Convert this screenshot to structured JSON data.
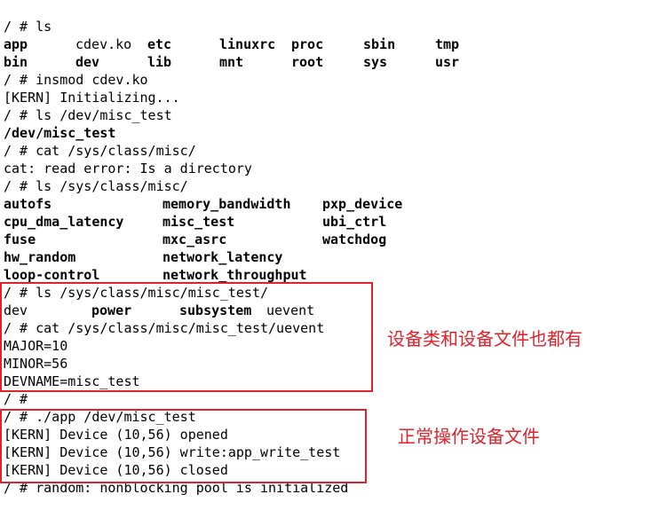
{
  "terminal": {
    "l01": "/ # ls",
    "ls_root": [
      "app",
      "cdev.ko",
      "etc",
      "linuxrc",
      "proc",
      "sbin",
      "tmp",
      "bin",
      "dev",
      "lib",
      "mnt",
      "root",
      "sys",
      "usr"
    ],
    "l04": "/ # insmod cdev.ko",
    "l05": "[KERN] Initializing...",
    "l06": "/ # ls /dev/misc_test",
    "l07": "/dev/misc_test",
    "l08": "/ # cat /sys/class/misc/",
    "l09": "cat: read error: Is a directory",
    "l10": "/ # ls /sys/class/misc/",
    "misc_list": [
      "autofs",
      "memory_bandwidth",
      "pxp_device",
      "cpu_dma_latency",
      "misc_test",
      "ubi_ctrl",
      "fuse",
      "mxc_asrc",
      "watchdog",
      "hw_random",
      "network_latency",
      "loop-control",
      "network_throughput"
    ],
    "l16": "/ # ls /sys/class/misc/misc_test/",
    "misc_test_list": [
      "dev",
      "power",
      "subsystem",
      "uevent"
    ],
    "l18": "/ # cat /sys/class/misc/misc_test/uevent",
    "l19": "MAJOR=10",
    "l20": "MINOR=56",
    "l21": "DEVNAME=misc_test",
    "l22": "/ #",
    "l23": "/ # ./app /dev/misc_test",
    "l24": "[KERN] Device (10,56) opened",
    "l25": "[KERN] Device (10,56) write:app_write_test",
    "l26": "[KERN] Device (10,56) closed",
    "l27": "/ # random: nonblocking pool is initialized"
  },
  "annotations": {
    "note1": "设备类和设备文件也都有",
    "note2": "正常操作设备文件"
  },
  "colors": {
    "highlight": "#e0222b",
    "text": "#000000",
    "background": "#ffffff"
  }
}
